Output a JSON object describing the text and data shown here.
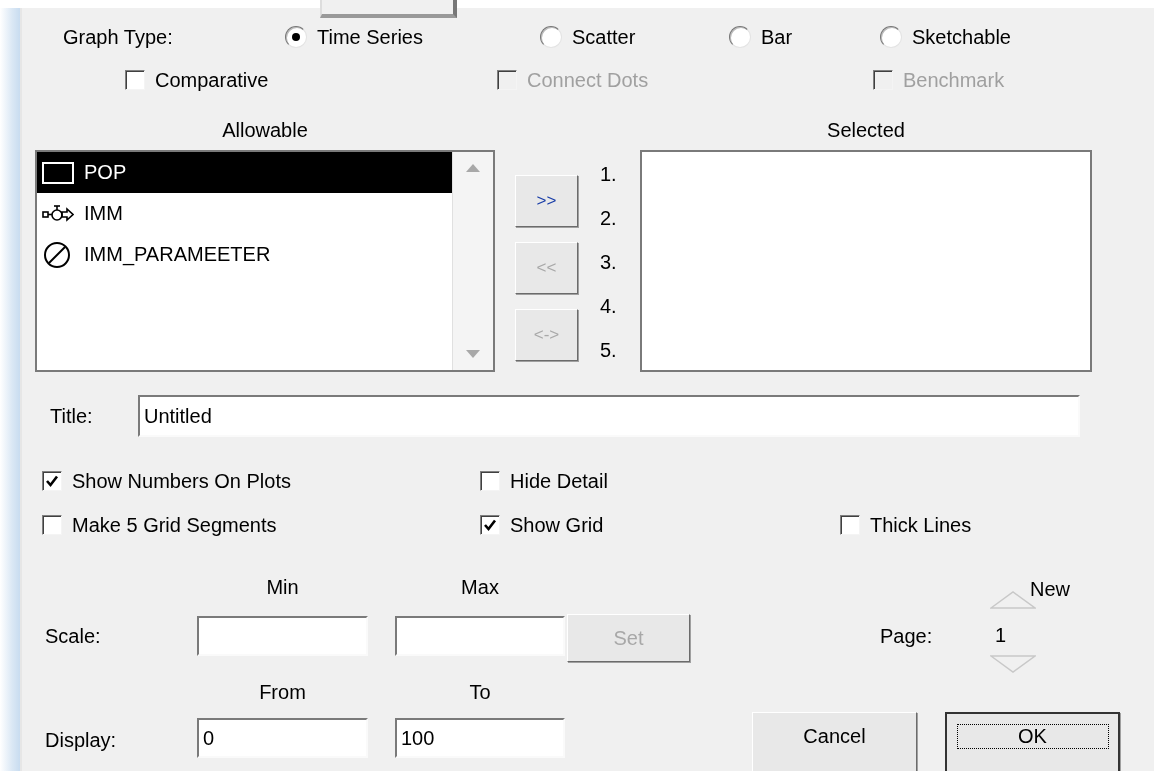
{
  "graph_type": {
    "label": "Graph Type:",
    "options": [
      {
        "label": "Time Series",
        "selected": true
      },
      {
        "label": "Scatter",
        "selected": false
      },
      {
        "label": "Bar",
        "selected": false
      },
      {
        "label": "Sketchable",
        "selected": false
      }
    ]
  },
  "graph_options": [
    {
      "label": "Comparative",
      "checked": false,
      "disabled": false
    },
    {
      "label": "Connect Dots",
      "checked": false,
      "disabled": true
    },
    {
      "label": "Benchmark",
      "checked": false,
      "disabled": true
    }
  ],
  "allowable": {
    "heading": "Allowable",
    "items": [
      {
        "label": "POP",
        "kind": "stock",
        "selected": true
      },
      {
        "label": "IMM",
        "kind": "flow",
        "selected": false
      },
      {
        "label": "IMM_PARAMEETER",
        "kind": "converter",
        "selected": false
      }
    ]
  },
  "transfer_buttons": [
    {
      "label": ">>",
      "disabled": false
    },
    {
      "label": "<<",
      "disabled": true
    },
    {
      "label": "<->",
      "disabled": true
    }
  ],
  "selected": {
    "heading": "Selected",
    "slots": [
      "1.",
      "2.",
      "3.",
      "4.",
      "5."
    ]
  },
  "title": {
    "label": "Title:",
    "value": "Untitled"
  },
  "checkbox_rows": [
    [
      {
        "label": "Show Numbers On Plots",
        "checked": true
      },
      {
        "label": "Hide Detail",
        "checked": false
      }
    ],
    [
      {
        "label": "Make 5 Grid Segments",
        "checked": false
      },
      {
        "label": "Show Grid",
        "checked": true
      },
      {
        "label": "Thick Lines",
        "checked": false
      }
    ]
  ],
  "scale": {
    "label": "Scale:",
    "min_label": "Min",
    "max_label": "Max",
    "set_button": {
      "label": "Set",
      "disabled": true
    }
  },
  "page": {
    "label": "Page:",
    "value": "1",
    "new_label": "New"
  },
  "display": {
    "label": "Display:",
    "from_label": "From",
    "to_label": "To",
    "from": "0",
    "to": "100"
  },
  "buttons": [
    {
      "label": "Cancel",
      "focused": false
    },
    {
      "label": "OK",
      "focused": true
    }
  ]
}
